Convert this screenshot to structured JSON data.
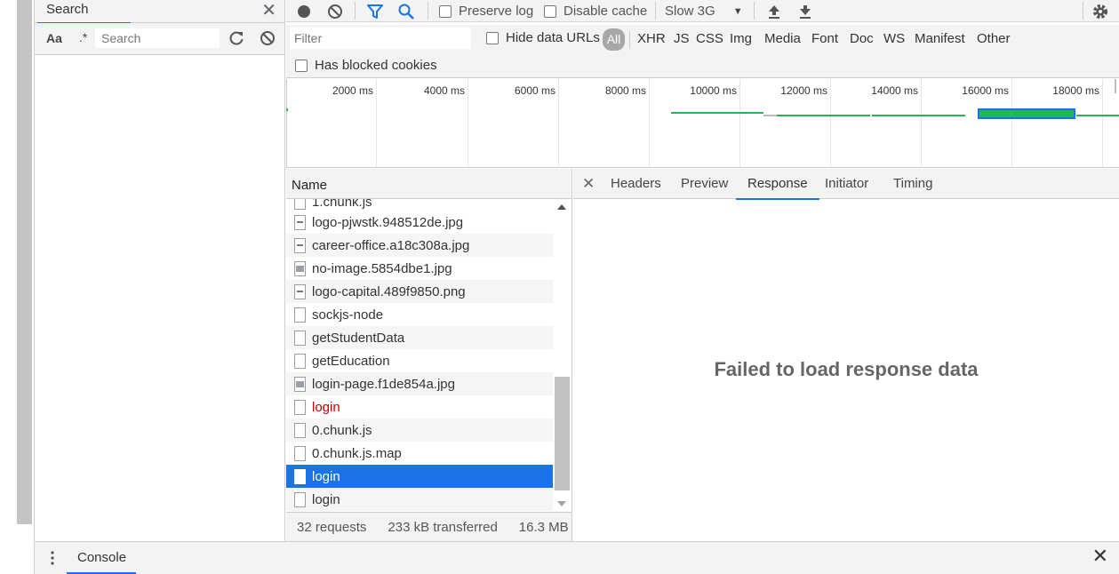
{
  "search_panel": {
    "tab_label": "Search",
    "match_case_label": "Aa",
    "regex_label": ".*",
    "placeholder": "Search"
  },
  "toolbar": {
    "preserve_log": "Preserve log",
    "disable_cache": "Disable cache",
    "throttling": "Slow 3G"
  },
  "filter": {
    "placeholder": "Filter",
    "hide_data_urls": "Hide data URLs",
    "types": [
      "All",
      "XHR",
      "JS",
      "CSS",
      "Img",
      "Media",
      "Font",
      "Doc",
      "WS",
      "Manifest",
      "Other"
    ],
    "has_blocked_cookies": "Has blocked cookies"
  },
  "overview": {
    "ticks": [
      "2000 ms",
      "4000 ms",
      "6000 ms",
      "8000 ms",
      "10000 ms",
      "12000 ms",
      "14000 ms",
      "16000 ms",
      "18000 ms"
    ]
  },
  "request_list": {
    "column_name": "Name",
    "rows": [
      {
        "name": "1.chunk.js",
        "icon": "doc"
      },
      {
        "name": "logo-pjwstk.948512de.jpg",
        "icon": "img"
      },
      {
        "name": "career-office.a18c308a.jpg",
        "icon": "img"
      },
      {
        "name": "no-image.5854dbe1.jpg",
        "icon": "pic"
      },
      {
        "name": "logo-capital.489f9850.png",
        "icon": "img"
      },
      {
        "name": "sockjs-node",
        "icon": "doc"
      },
      {
        "name": "getStudentData",
        "icon": "doc"
      },
      {
        "name": "getEducation",
        "icon": "doc"
      },
      {
        "name": "login-page.f1de854a.jpg",
        "icon": "pic"
      },
      {
        "name": "login",
        "icon": "doc",
        "status": "error"
      },
      {
        "name": "0.chunk.js",
        "icon": "doc"
      },
      {
        "name": "0.chunk.js.map",
        "icon": "doc"
      },
      {
        "name": "login",
        "icon": "doc",
        "status": "selected"
      },
      {
        "name": "login",
        "icon": "doc"
      }
    ],
    "summary": {
      "requests": "32 requests",
      "transferred": "233 kB transferred",
      "resources": "16.3 MB r"
    }
  },
  "details": {
    "tabs": [
      "Headers",
      "Preview",
      "Response",
      "Initiator",
      "Timing"
    ],
    "active_tab": "Response",
    "message": "Failed to load response data"
  },
  "drawer": {
    "tab_label": "Console"
  },
  "colors": {
    "accent": "#1a73e8",
    "waterfall": "#1db954",
    "error": "#c80000"
  }
}
